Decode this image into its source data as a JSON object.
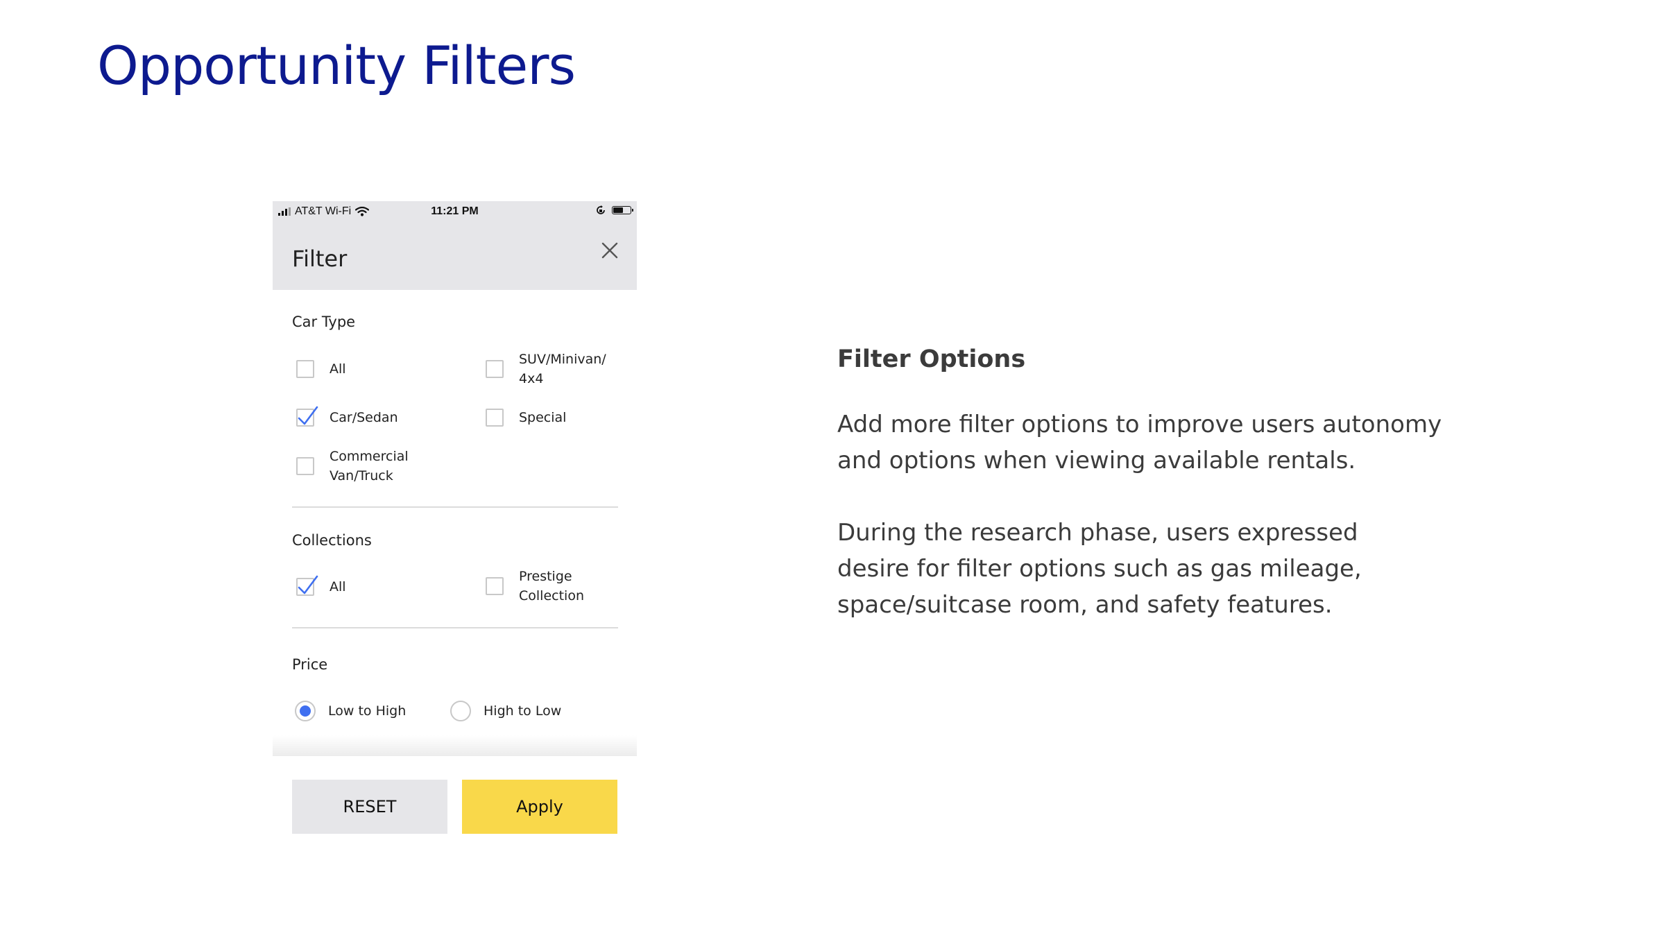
{
  "slide": {
    "title_part1": "Opportunity",
    "title_part2": "Filters",
    "title_color": "#0d1a8f"
  },
  "status_bar": {
    "carrier": "AT&T Wi-Fi",
    "time": "11:21 PM",
    "icons": [
      "signal-icon",
      "wifi-icon",
      "orientation-lock-icon",
      "battery-icon"
    ]
  },
  "filter": {
    "title": "Filter",
    "close_icon": "close-icon",
    "car_type": {
      "label": "Car Type",
      "options": [
        {
          "lines": [
            "All"
          ],
          "checked": false
        },
        {
          "lines": [
            "SUV/Minivan/",
            "4x4"
          ],
          "checked": false
        },
        {
          "lines": [
            "Car/Sedan"
          ],
          "checked": true
        },
        {
          "lines": [
            "Special"
          ],
          "checked": false
        },
        {
          "lines": [
            "Commercial",
            "Van/Truck"
          ],
          "checked": false
        }
      ]
    },
    "collections": {
      "label": "Collections",
      "options": [
        {
          "lines": [
            "All"
          ],
          "checked": true
        },
        {
          "lines": [
            "Prestige",
            "Collection"
          ],
          "checked": false
        }
      ]
    },
    "price": {
      "label": "Price",
      "options": [
        {
          "label": "Low to High",
          "selected": true
        },
        {
          "label": "High to Low",
          "selected": false
        }
      ]
    },
    "reset_label": "RESET",
    "apply_label": "Apply"
  },
  "info": {
    "heading": "Filter Options",
    "para1_lines": [
      "Add more filter options to improve users autonomy",
      "and options when viewing available rentals."
    ],
    "para2_lines": [
      "During the research phase, users expressed",
      "desire for filter options such as gas mileage,",
      "space/suitcase room, and safety features."
    ]
  },
  "colors": {
    "header_bg": "#e6e6e9",
    "check_blue": "#3f6ff0",
    "apply_yellow": "#f9d84a",
    "reset_gray": "#e6e6e9",
    "body_text": "#3b3b3b"
  }
}
